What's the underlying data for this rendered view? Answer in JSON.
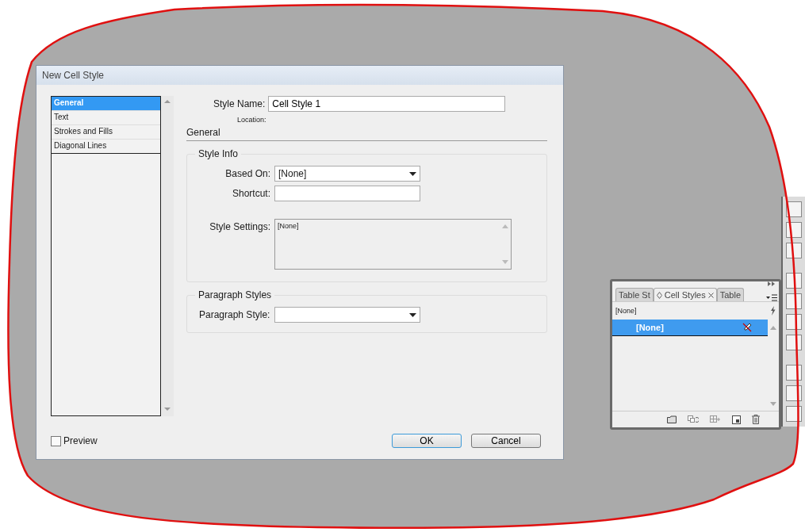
{
  "dialog": {
    "title": "New Cell Style",
    "categories": [
      {
        "label": "General",
        "selected": true
      },
      {
        "label": "Text",
        "selected": false
      },
      {
        "label": "Strokes and Fills",
        "selected": false
      },
      {
        "label": "Diagonal Lines",
        "selected": false
      }
    ],
    "style_name": {
      "label": "Style Name:",
      "value": "Cell Style 1"
    },
    "location_label": "Location:",
    "section_title": "General",
    "style_info": {
      "title": "Style Info",
      "based_on": {
        "label": "Based On:",
        "value": "[None]"
      },
      "shortcut": {
        "label": "Shortcut:"
      },
      "style_settings": {
        "label": "Style Settings:",
        "value": "[None]"
      }
    },
    "paragraph_styles": {
      "title": "Paragraph Styles",
      "paragraph_style": {
        "label": "Paragraph Style:"
      }
    },
    "preview": {
      "label": "Preview",
      "checked": false
    },
    "buttons": [
      {
        "label": "OK",
        "kind": "default"
      },
      {
        "label": "Cancel",
        "kind": "normal"
      }
    ]
  },
  "panel": {
    "tabs": [
      {
        "label": "Table St",
        "selected": false
      },
      {
        "label": "Cell Styles",
        "selected": true
      },
      {
        "label": "Table",
        "selected": false
      }
    ],
    "current_style": "[None]",
    "styles": [
      {
        "label": "[None]",
        "selected": true
      }
    ]
  }
}
